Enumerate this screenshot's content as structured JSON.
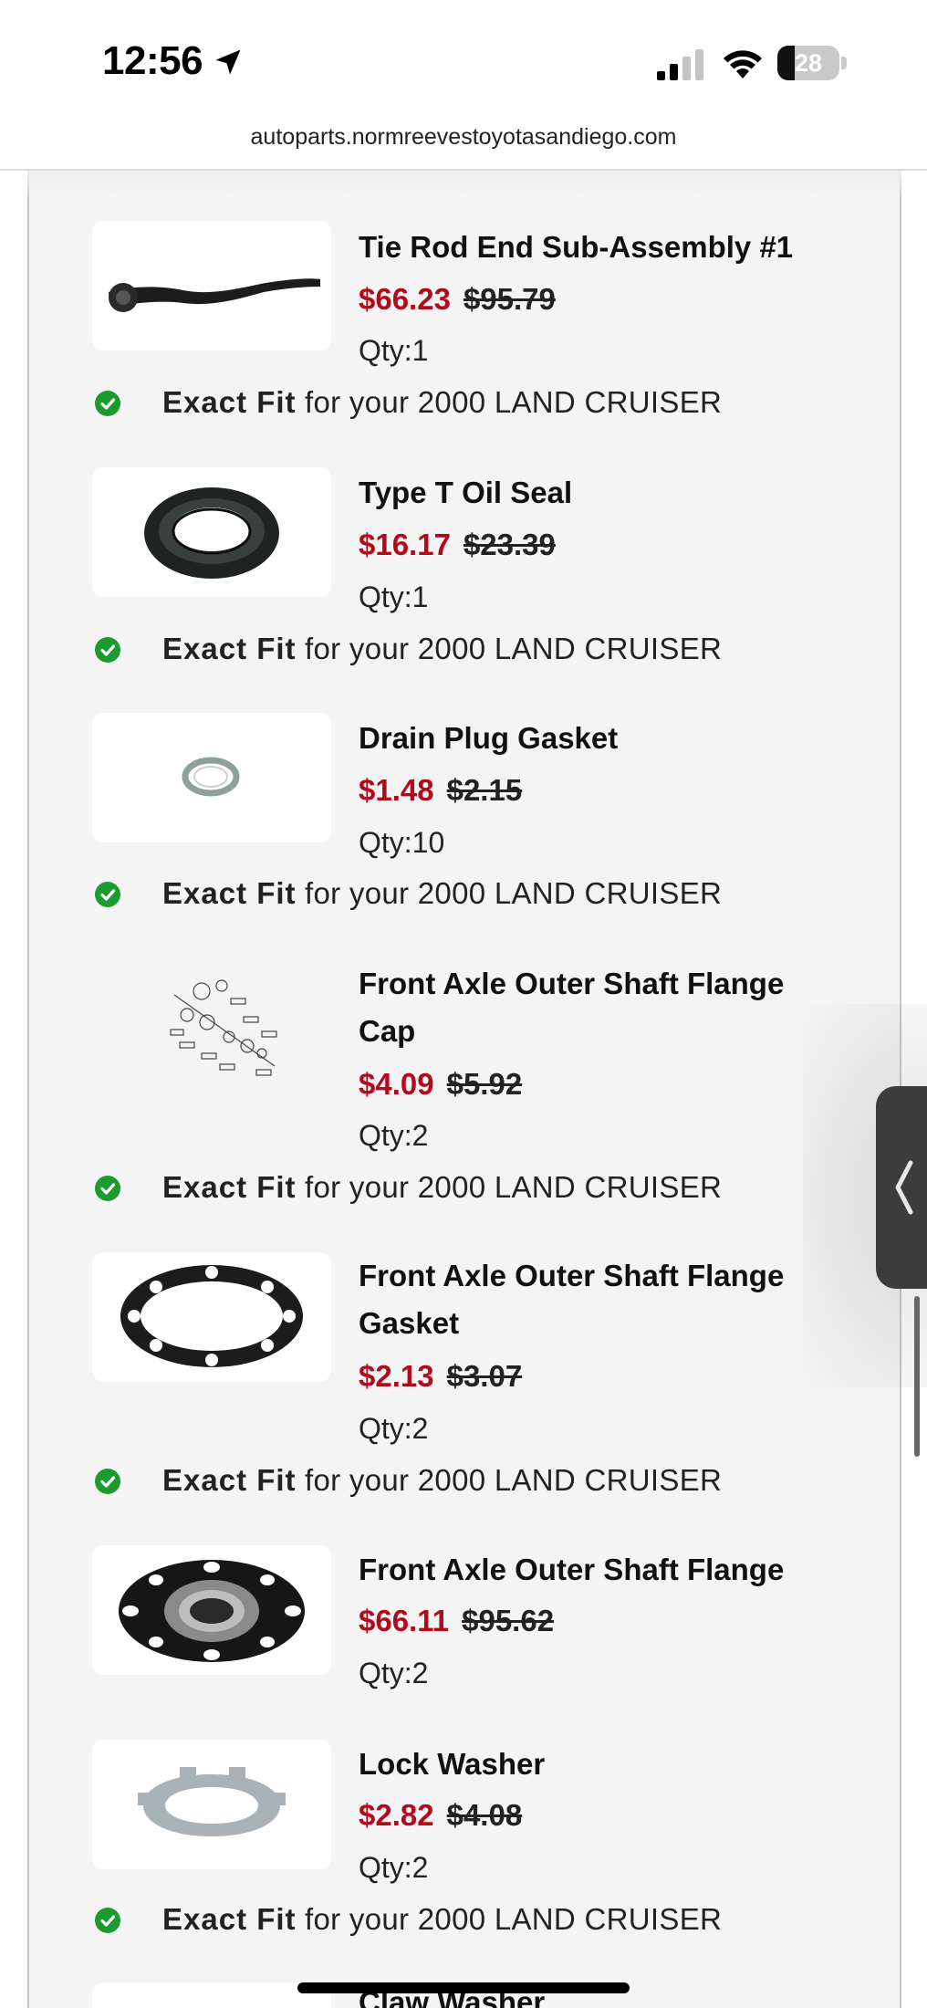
{
  "status_bar": {
    "time": "12:56",
    "battery_level": "28",
    "battery_percent": 28,
    "icons": [
      "location-arrow-icon",
      "cellular-signal-icon",
      "wifi-icon",
      "battery-icon"
    ]
  },
  "browser": {
    "url": "autoparts.normreevestoyotasandiego.com"
  },
  "fit_label": {
    "strong": "Exact Fit",
    "rest": " for your 2000 LAND CRUISER"
  },
  "items": [
    {
      "name": "Tie Rod End Sub-Assembly #1",
      "sale_price": "$66.23",
      "orig_price": "$95.79",
      "qty": "Qty:1",
      "image": "tie-rod-image"
    },
    {
      "name": "Type T Oil Seal",
      "sale_price": "$16.17",
      "orig_price": "$23.39",
      "qty": "Qty:1",
      "image": "oil-seal-image"
    },
    {
      "name": "Drain Plug Gasket",
      "sale_price": "$1.48",
      "orig_price": "$2.15",
      "qty": "Qty:10",
      "image": "gasket-ring-image"
    },
    {
      "name": "Front Axle Outer Shaft Flange Cap",
      "sale_price": "$4.09",
      "orig_price": "$5.92",
      "qty": "Qty:2",
      "image": "parts-diagram-image"
    },
    {
      "name": "Front Axle Outer Shaft Flange Gasket",
      "sale_price": "$2.13",
      "orig_price": "$3.07",
      "qty": "Qty:2",
      "image": "flange-gasket-image"
    },
    {
      "name": "Front Axle Outer Shaft Flange",
      "sale_price": "$66.11",
      "orig_price": "$95.62",
      "qty": "Qty:2",
      "image": "flange-image"
    },
    {
      "name": "Lock Washer",
      "sale_price": "$2.82",
      "orig_price": "$4.08",
      "qty": "Qty:2",
      "image": "lock-washer-image"
    },
    {
      "name": "Claw Washer",
      "image": "claw-washer-image"
    }
  ],
  "colors": {
    "sale_price": "#b20a1b",
    "check": "#1a9a2f",
    "panel_bg": "#f4f4f4"
  }
}
